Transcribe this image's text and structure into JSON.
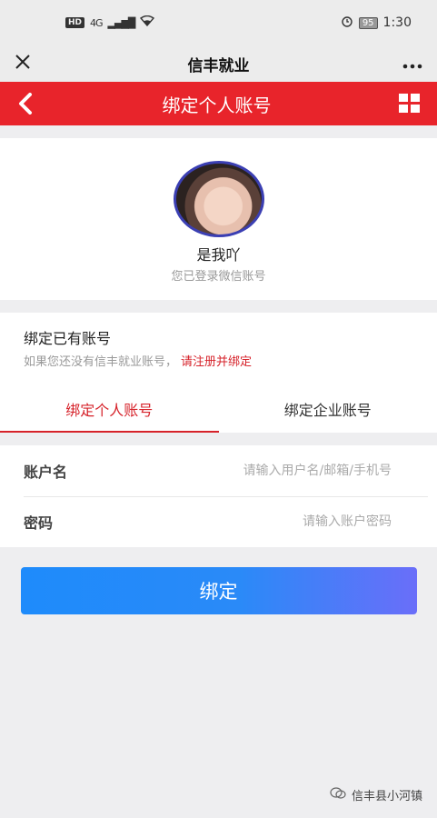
{
  "status_bar": {
    "network": "4G",
    "battery": "95",
    "time": "1:30",
    "hd": "HD"
  },
  "mini_program": {
    "title": "信丰就业"
  },
  "header": {
    "title": "绑定个人账号"
  },
  "profile": {
    "nickname": "是我吖",
    "login_note": "您已登录微信账号"
  },
  "bind": {
    "title": "绑定已有账号",
    "hint": "如果您还没有信丰就业账号，",
    "register_link": "请注册并绑定",
    "tabs": [
      {
        "label": "绑定个人账号",
        "active": true
      },
      {
        "label": "绑定企业账号",
        "active": false
      }
    ]
  },
  "form": {
    "account_label": "账户名",
    "account_placeholder": "请输入用户名/邮箱/手机号",
    "password_label": "密码",
    "password_placeholder": "请输入账户密码"
  },
  "submit_label": "绑定",
  "watermark": "信丰县小河镇",
  "colors": {
    "brand_red": "#e8242b",
    "button_start": "#1e8bfb",
    "button_end": "#6a6ef9"
  }
}
